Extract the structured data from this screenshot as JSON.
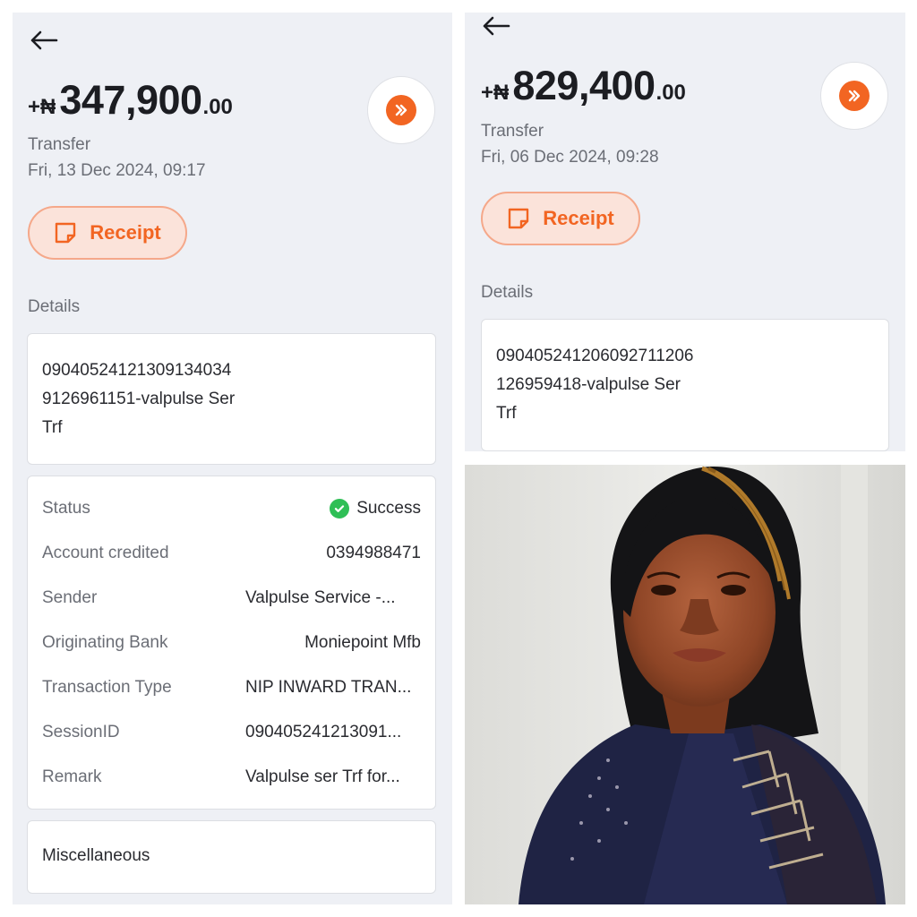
{
  "left": {
    "amount_sign": "+₦",
    "amount_int": "347,900",
    "amount_dec": ".00",
    "type": "Transfer",
    "datetime": "Fri, 13 Dec 2024, 09:17",
    "receipt_label": "Receipt",
    "details_label": "Details",
    "details_lines": [
      "09040524121309134034",
      "9126961151-valpulse Ser",
      "Trf"
    ],
    "rows": [
      {
        "label": "Status",
        "value": "Success"
      },
      {
        "label": "Account credited",
        "value": "0394988471"
      },
      {
        "label": "Sender",
        "value": "Valpulse Service -..."
      },
      {
        "label": "Originating Bank",
        "value": "Moniepoint Mfb"
      },
      {
        "label": "Transaction Type",
        "value": "NIP INWARD TRAN..."
      },
      {
        "label": "SessionID",
        "value": "090405241213091..."
      },
      {
        "label": "Remark",
        "value": "Valpulse ser Trf for..."
      }
    ],
    "misc_label": "Miscellaneous"
  },
  "right": {
    "amount_sign": "+₦",
    "amount_int": "829,400",
    "amount_dec": ".00",
    "type": "Transfer",
    "datetime": "Fri, 06 Dec 2024, 09:28",
    "receipt_label": "Receipt",
    "details_label": "Details",
    "details_lines": [
      "090405241206092711206",
      "126959418-valpulse Ser",
      "Trf"
    ]
  },
  "icons": {
    "back": "arrow-left-icon",
    "forward": "double-chevron-right-icon",
    "receipt": "receipt-note-icon",
    "status": "check-circle-icon"
  },
  "colors": {
    "accent": "#f26522",
    "receipt_bg": "#fbe3da",
    "success": "#2fbf56",
    "panel_bg": "#eef0f5"
  }
}
